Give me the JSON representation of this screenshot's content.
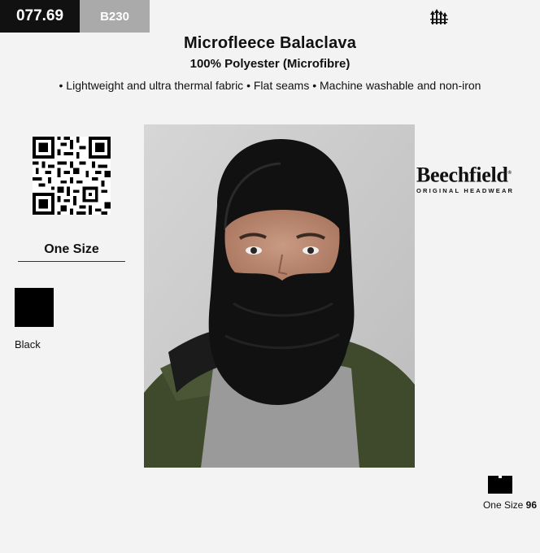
{
  "header": {
    "code": "077.69",
    "sku": "B230"
  },
  "product": {
    "title": "Microfleece Balaclava",
    "material": "100% Polyester (Microfibre)",
    "features": "• Lightweight and ultra thermal fabric • Flat seams • Machine washable and non-iron"
  },
  "sizes": {
    "label": "One Size"
  },
  "colors": [
    {
      "name": "Black",
      "hex": "#000000"
    }
  ],
  "brand": {
    "name": "Beechfield",
    "tagline": "ORIGINAL HEADWEAR",
    "registered": "®"
  },
  "packaging": {
    "size_label": "One Size",
    "quantity": "96",
    "icon": "carton-icon"
  },
  "icons": {
    "brand_mark": "tree-mark-icon",
    "qr": "qr-code-icon"
  }
}
